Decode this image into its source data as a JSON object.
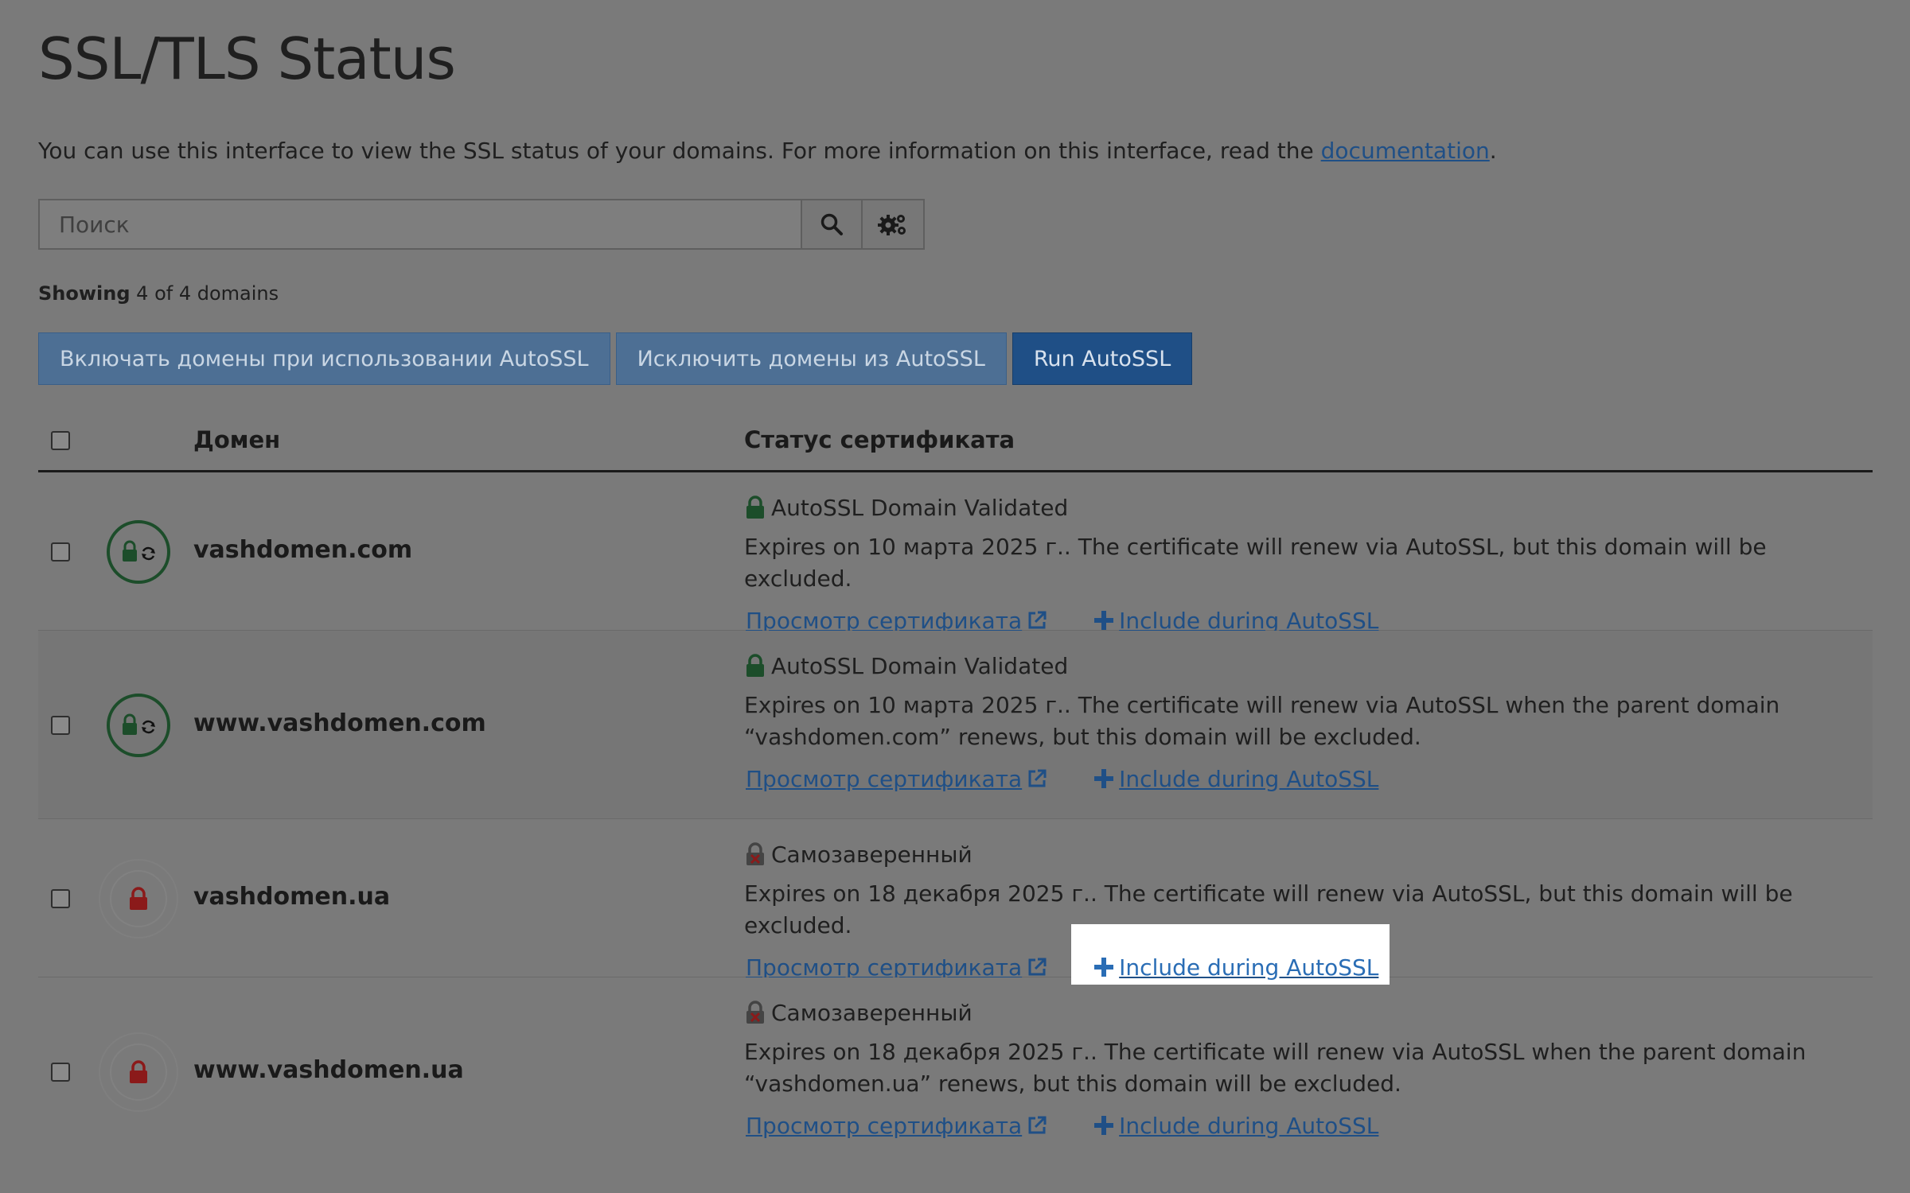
{
  "page": {
    "title": "SSL/TLS Status",
    "intro_text": "You can use this interface to view the SSL status of your domains. For more information on this interface, read the ",
    "intro_link": "documentation",
    "intro_end": "."
  },
  "search": {
    "placeholder": "Поиск",
    "value": "",
    "search_icon": "search-icon",
    "settings_icon": "gears-icon"
  },
  "showing": {
    "label": "Showing",
    "text": "4 of 4 domains"
  },
  "actions": {
    "include_label": "Включать домены при использовании AutoSSL",
    "exclude_label": "Исключить домены из AutoSSL",
    "run_label": "Run AutoSSL"
  },
  "table": {
    "col_domain": "Домен",
    "col_status": "Статус сертификата",
    "rows": [
      {
        "domain": "vashdomen.com",
        "status_icon": "lock-green",
        "status": "AutoSSL Domain Validated",
        "desc": "Expires on 10 марта 2025 г.. The certificate will renew via AutoSSL, but this domain will be excluded.",
        "view_label": "Просмотр сертификата",
        "include_label": "Include during AutoSSL"
      },
      {
        "domain": "www.vashdomen.com",
        "status_icon": "lock-green",
        "status": "AutoSSL Domain Validated",
        "desc": "Expires on 10 марта 2025 г.. The certificate will renew via AutoSSL when the parent domain “vashdomen.com” renews, but this domain will be excluded.",
        "view_label": "Просмотр сертификата",
        "include_label": "Include during AutoSSL"
      },
      {
        "domain": "vashdomen.ua",
        "status_icon": "lock-self-signed",
        "status": "Самозаверенный",
        "desc": "Expires on 18 декабря 2025 г.. The certificate will renew via AutoSSL, but this domain will be excluded.",
        "view_label": "Просмотр сертификата",
        "include_label": "Include during AutoSSL"
      },
      {
        "domain": "www.vashdomen.ua",
        "status_icon": "lock-self-signed",
        "status": "Самозаверенный",
        "desc": "Expires on 18 декабря 2025 г.. The certificate will renew via AutoSSL when the parent domain “vashdomen.ua” renews, but this domain will be excluded.",
        "view_label": "Просмотр сертификата",
        "include_label": "Include during AutoSSL"
      }
    ]
  },
  "colors": {
    "link": "#1f4f86",
    "ok_green": "#1c4d2a",
    "error_red": "#8b1a1a",
    "highlight": "#ffffff"
  }
}
